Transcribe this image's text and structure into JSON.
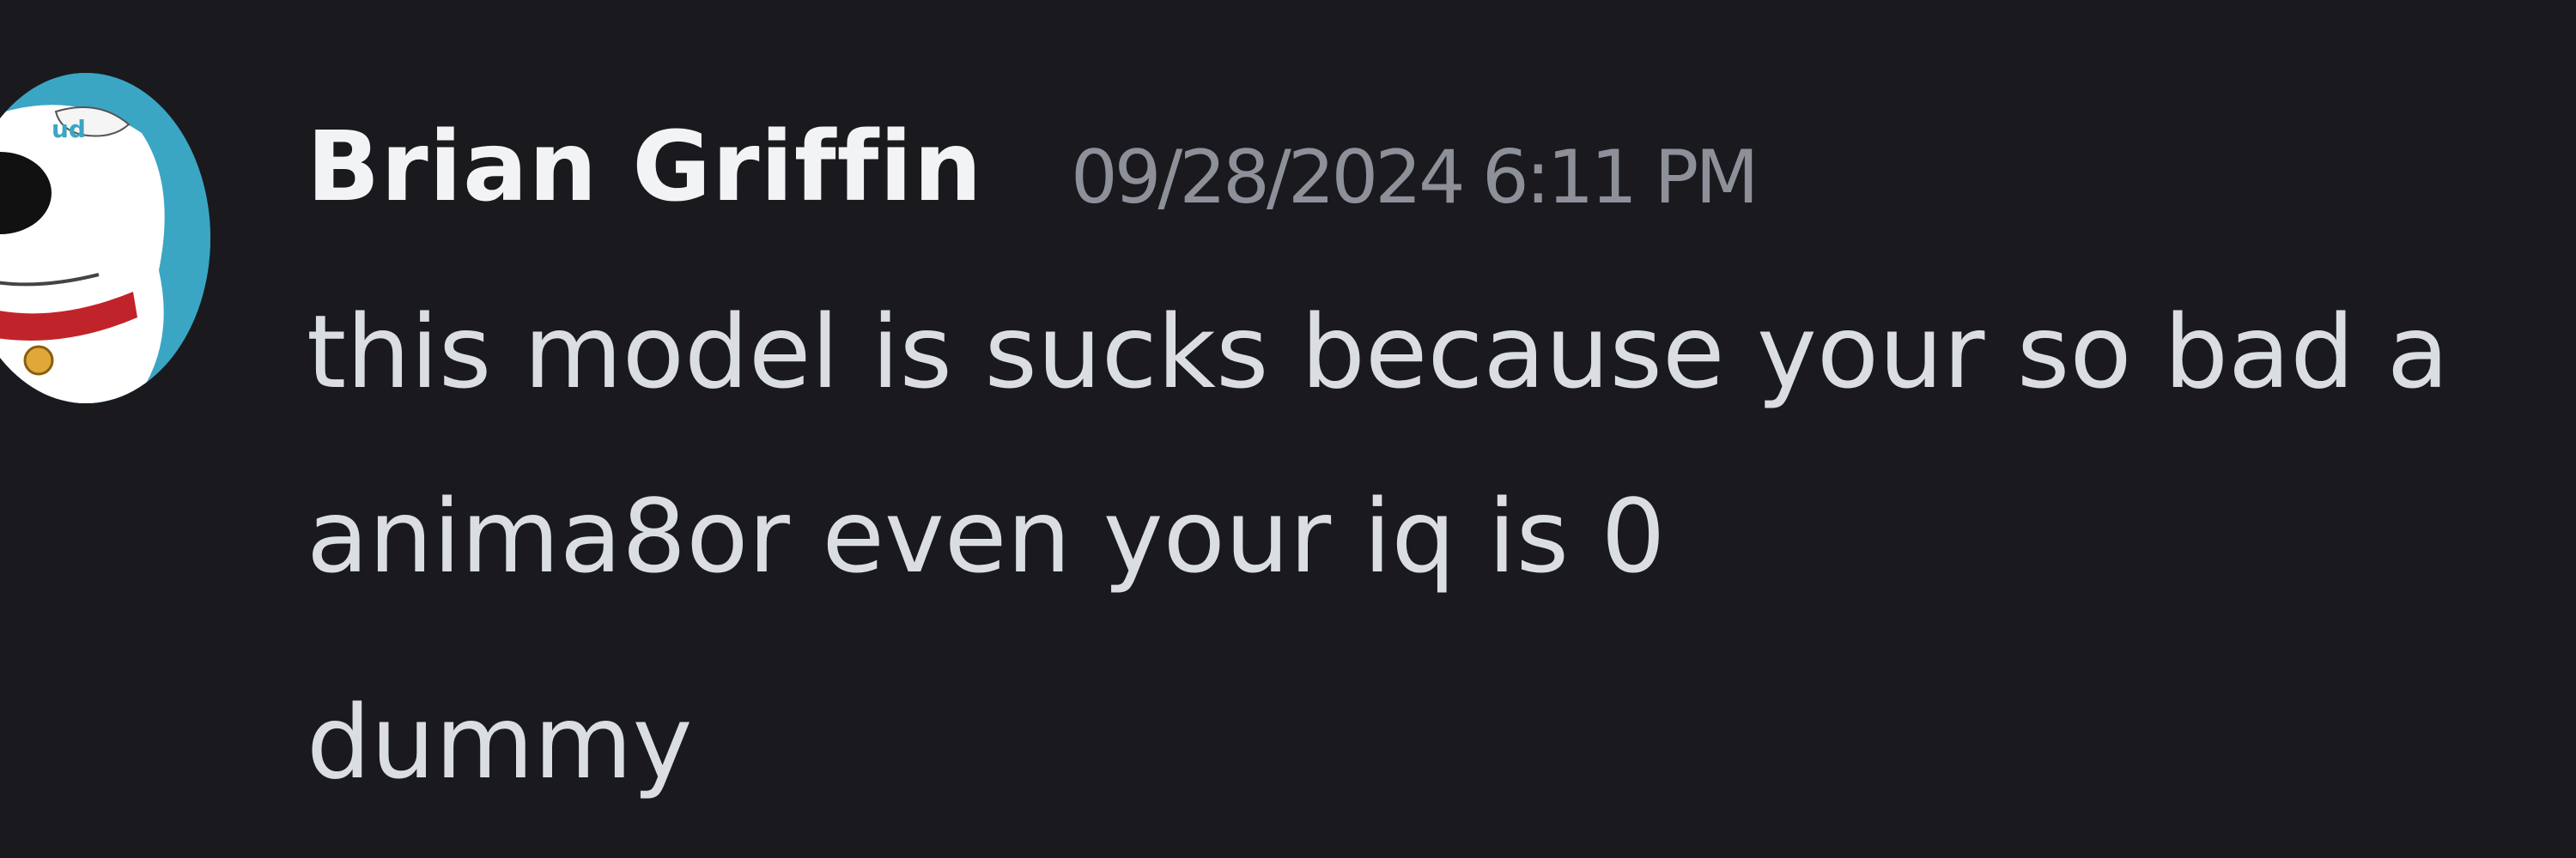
{
  "message": {
    "author": "Brian Griffin",
    "timestamp": "09/28/2024 6:11 PM",
    "lines": [
      "this model is sucks because your so bad a",
      "anima8or even your iq is 0",
      "dummy"
    ]
  },
  "colors": {
    "background": "#1a1a1e",
    "author": "#f2f3f5",
    "timestamp": "#8e9099",
    "text": "#dbdee1",
    "avatar_bg": "#3aa6c4"
  },
  "icons": {
    "avatar": "brian-griffin-dog-avatar"
  }
}
